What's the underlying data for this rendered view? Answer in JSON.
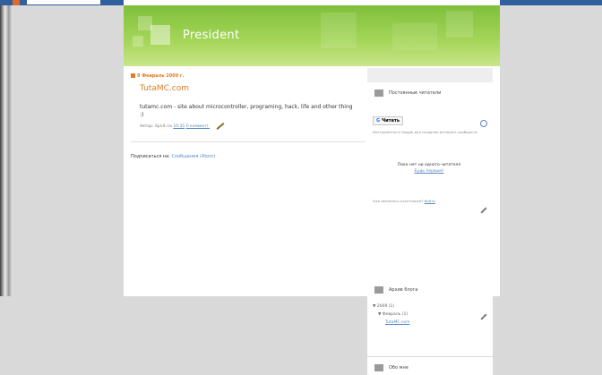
{
  "blog": {
    "title": "President"
  },
  "post": {
    "date": "9 Февраль 2009 г.",
    "title": "TutaMC.com",
    "body": "tutamc.com - site about microcontroller, programing, hack, life and other thing :)",
    "footer_prefix": "Автор: Spirit на",
    "footer_time": "10:35",
    "footer_comments": "0 коммент."
  },
  "subscribe": {
    "label": "Подписаться на:",
    "link": "Сообщения (Atom)"
  },
  "sidebar": {
    "followers": {
      "title": "Постоянные читатели",
      "button": "Читать",
      "note": "Инструменты в Google для создания интернет-сообществ",
      "none": "Пока нет ни одного читателя",
      "first": "Будь первым!",
      "already_text": "Уже являетесь участником?",
      "already_link": "Войти"
    },
    "archive": {
      "title": "Архив блога",
      "year": "▼ 2009 (1)",
      "month": "▼ Февраль (1)",
      "post": "TutaMC.com"
    },
    "about": {
      "title": "Обо мне"
    }
  }
}
